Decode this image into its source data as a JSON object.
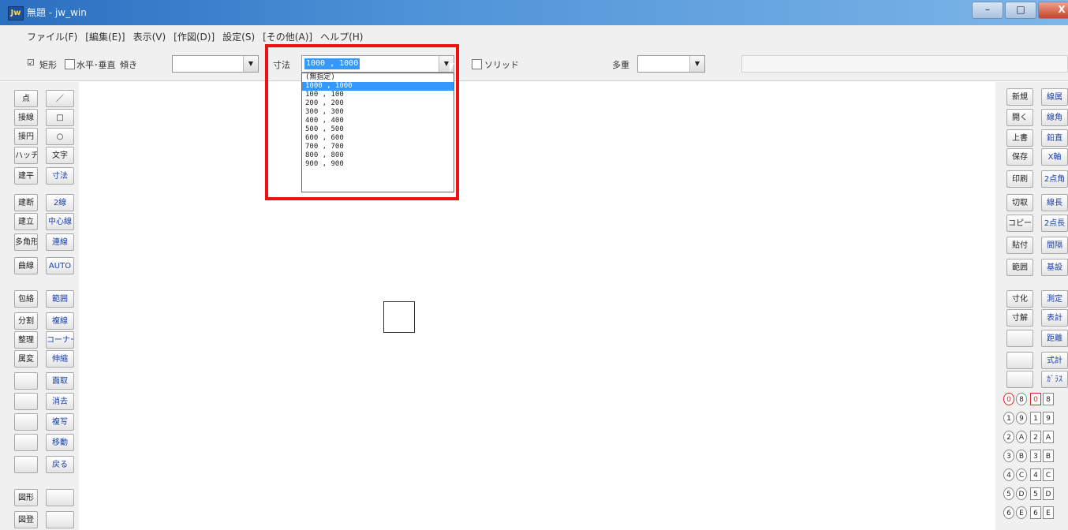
{
  "window": {
    "title": "無題 - jw_win",
    "icon_label": "Jw",
    "controls": {
      "minimize": "–",
      "maximize": "□",
      "close": "X"
    }
  },
  "menu": [
    "ファイル(F)",
    "[編集(E)]",
    "表示(V)",
    "[作図(D)]",
    "設定(S)",
    "[その他(A)]",
    "ヘルプ(H)"
  ],
  "toolbar": {
    "rect_check": "☑",
    "rect_label": "矩形",
    "hv_label": "水平･垂直",
    "tilt_label": "傾き",
    "tilt_value": "",
    "dim_label": "寸法",
    "dim_value": "1000 , 1000",
    "solid_label": "ソリッド",
    "multiple_label": "多重",
    "multiple_value": ""
  },
  "dropdown": {
    "items": [
      "(無指定)",
      "1000 , 1000",
      "100 , 100",
      "200 , 200",
      "300 , 300",
      "400 , 400",
      "500 , 500",
      "600 , 600",
      "700 , 700",
      "800 , 800",
      "900 , 900"
    ],
    "selected_index": 1
  },
  "left_tools": [
    [
      "点",
      "／"
    ],
    [
      "接線",
      "□"
    ],
    [
      "接円",
      "○"
    ],
    [
      "ハッチ",
      "文字"
    ],
    [
      "建平",
      "寸法"
    ],
    [
      "建断",
      "2線"
    ],
    [
      "建立",
      "中心線"
    ],
    [
      "多角形",
      "連線"
    ],
    [
      "曲線",
      "AUTO"
    ],
    [
      "包絡",
      "範囲"
    ],
    [
      "分割",
      "複線"
    ],
    [
      "整理",
      "コーナー"
    ],
    [
      "属変",
      "伸縮"
    ],
    [
      "",
      "面取"
    ],
    [
      "",
      "消去"
    ],
    [
      "",
      "複写"
    ],
    [
      "",
      "移動"
    ],
    [
      "",
      "戻る"
    ],
    [
      "図形",
      ""
    ],
    [
      "図登",
      ""
    ]
  ],
  "right_tools": [
    [
      "新規",
      "線属"
    ],
    [
      "開く",
      "線角"
    ],
    [
      "上書",
      "鉛直"
    ],
    [
      "保存",
      "X軸"
    ],
    [
      "印刷",
      "2点角"
    ],
    [
      "切取",
      "線長"
    ],
    [
      "コピー",
      "2点長"
    ],
    [
      "貼付",
      "間隔"
    ],
    [
      "範囲",
      "基設"
    ],
    [
      "寸化",
      "測定"
    ],
    [
      "寸解",
      "表計"
    ],
    [
      "",
      "距離"
    ],
    [
      "",
      "式計"
    ],
    [
      "",
      "ｶﾞﾗｽ"
    ]
  ],
  "layers": {
    "circled": [
      "0",
      "8",
      "1",
      "9",
      "2",
      "A",
      "3",
      "B",
      "4",
      "C",
      "5",
      "D",
      "6",
      "E"
    ],
    "squared": [
      "0",
      "8",
      "1",
      "9",
      "2",
      "A",
      "3",
      "B",
      "4",
      "C",
      "5",
      "D",
      "6",
      "E"
    ]
  }
}
